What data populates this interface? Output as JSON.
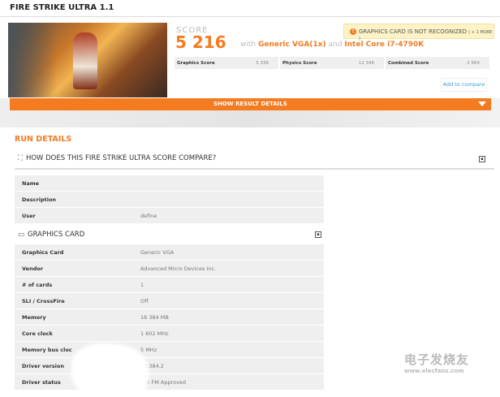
{
  "title": "FIRE STRIKE ULTRA 1.1",
  "score": {
    "label": "SCORE",
    "value": "5 216",
    "with": "with",
    "gpu": "Generic VGA(1x)",
    "and": "and",
    "cpu": "Intel Core i7-4790K"
  },
  "warning": {
    "text": "GRAPHICS CARD IS NOT RECOGNIZED",
    "more": "( + 1 MORE )"
  },
  "subscores": [
    {
      "label": "Graphics Score",
      "value": "5 336"
    },
    {
      "label": "Physics Score",
      "value": "12 346"
    },
    {
      "label": "Combined Score",
      "value": "2 564"
    }
  ],
  "add_compare": "Add to compare",
  "show_details": "SHOW RESULT DETAILS",
  "run_details": "RUN DETAILS",
  "compare_section": "HOW DOES THIS FIRE STRIKE ULTRA SCORE COMPARE?",
  "run_rows": [
    {
      "k": "Name",
      "v": ""
    },
    {
      "k": "Description",
      "v": ""
    },
    {
      "k": "User",
      "v": "define"
    }
  ],
  "gpu_section": "GRAPHICS CARD",
  "gpu_rows": [
    {
      "k": "Graphics Card",
      "v": "Generic VGA"
    },
    {
      "k": "Vendor",
      "v": "Advanced Micro Devices Inc."
    },
    {
      "k": "# of cards",
      "v": "1"
    },
    {
      "k": "SLI / CrossFire",
      "v": "Off"
    },
    {
      "k": "Memory",
      "v": "16 384 MB"
    },
    {
      "k": "Core clock",
      "v": "1 602 MHz"
    },
    {
      "k": "Memory bus cloc",
      "v": "5 MHz"
    },
    {
      "k": "Driver version",
      "v": "19.384.2"
    },
    {
      "k": "Driver status",
      "v": "Not FM Approved"
    }
  ],
  "watermark": {
    "cn": "电子发烧友",
    "url": "www.elecfans.com"
  },
  "colors": {
    "accent": "#f47b20",
    "link": "#3a9fd6",
    "warning_bg": "#fdf3c6"
  }
}
